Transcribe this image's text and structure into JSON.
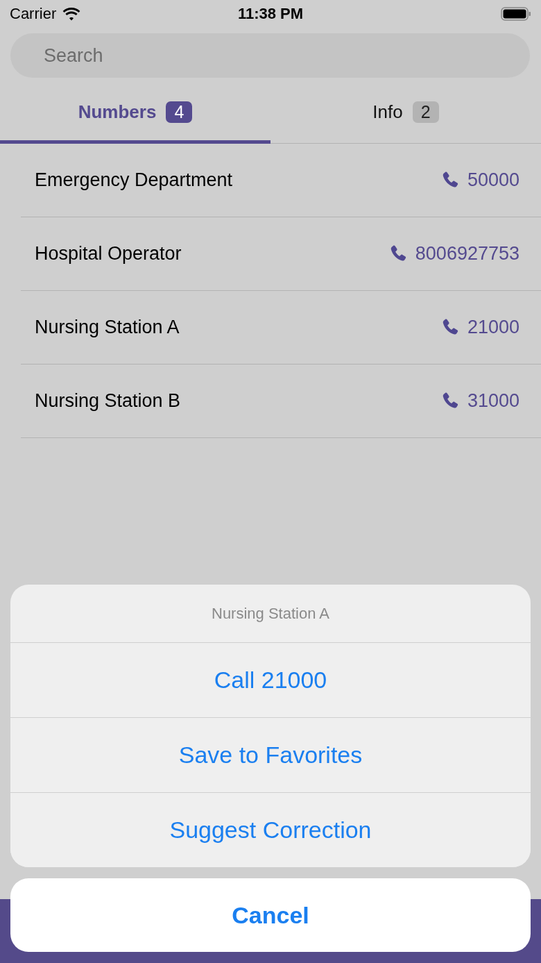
{
  "status_bar": {
    "carrier": "Carrier",
    "time": "11:38 PM"
  },
  "search": {
    "placeholder": "Search"
  },
  "tabs": [
    {
      "label": "Numbers",
      "count": "4",
      "selected": true
    },
    {
      "label": "Info",
      "count": "2",
      "selected": false
    }
  ],
  "rows": [
    {
      "name": "Emergency Department",
      "number": "50000"
    },
    {
      "name": "Hospital Operator",
      "number": "8006927753"
    },
    {
      "name": "Nursing Station A",
      "number": "21000"
    },
    {
      "name": "Nursing Station B",
      "number": "31000"
    }
  ],
  "action_sheet": {
    "title": "Nursing Station A",
    "actions": [
      "Call 21000",
      "Save to Favorites",
      "Suggest Correction"
    ],
    "cancel": "Cancel"
  }
}
